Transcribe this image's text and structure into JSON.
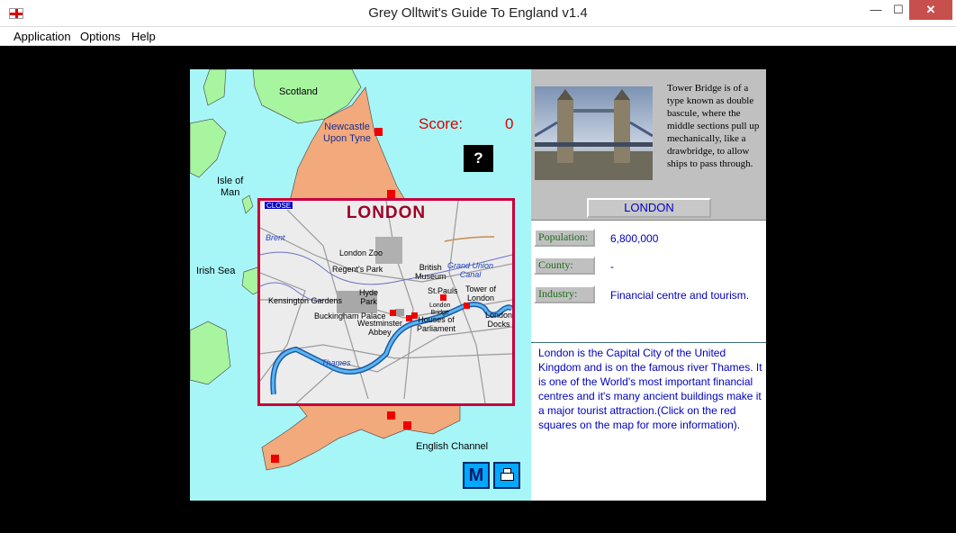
{
  "window": {
    "title": "Grey Olltwit's Guide To England v1.4",
    "minimize_glyph": "—",
    "maximize_glyph": "☐",
    "close_glyph": "✕"
  },
  "menu": {
    "items": [
      "Application",
      "Options",
      "Help"
    ]
  },
  "map": {
    "labels": {
      "scotland": "Scotland",
      "newcastle": "Newcastle\nUpon Tyne",
      "isle_of_man": "Isle of\nMan",
      "irish_sea": "Irish Sea",
      "english_channel": "English Channel"
    },
    "score_label": "Score:",
    "score_value": "0",
    "help_label": "?",
    "map_button_label": "M"
  },
  "london_inset": {
    "close_label": "CLOSE",
    "title": "LONDON",
    "places": {
      "brent": "Brent",
      "london_zoo": "London Zoo",
      "regents_park": "Regent's Park",
      "british_museum": "British\nMuseum",
      "grand_union": "Grand Union\nCanal",
      "kensington": "Kensington Gardens",
      "hyde_park": "Hyde\nPark",
      "st_pauls": "St.Pauls",
      "tower": "Tower of\nLondon",
      "london_bridge": "London\nBridge",
      "buckingham": "Buckingham Palace",
      "westminster": "Westminster\nAbbey",
      "parliament": "Houses of\nParliament",
      "docks": "London\nDocks",
      "thames": "Thames"
    }
  },
  "info": {
    "photo_caption": "Tower Bridge is of a type known as double bascule, where the middle sections pull up mechanically, like a drawbridge,  to allow ships to pass through.",
    "city_name": "LONDON",
    "facts": [
      {
        "label": "Population:",
        "value": "6,800,000"
      },
      {
        "label": "County:",
        "value": "-"
      },
      {
        "label": "Industry:",
        "value": "Financial centre and tourism."
      }
    ],
    "description": "London is the Capital City of the United Kingdom and is on the famous river Thames. It is one of the World's most important financial centres and it's many ancient buildings make it a major tourist attraction.(Click on the red squares on the map for more information)."
  },
  "colors": {
    "sea": "#a7f6f7",
    "land_scotland": "#a8f5a0",
    "land_england": "#f2a97c",
    "marker": "#e00000",
    "inset_border": "#c8003c"
  }
}
